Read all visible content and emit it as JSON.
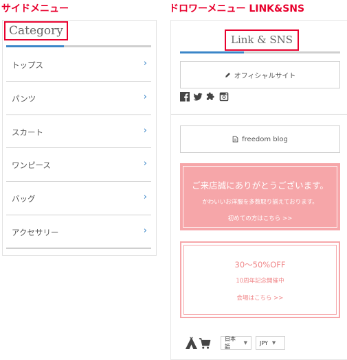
{
  "captions": {
    "side_menu": "サイドメニュー",
    "drawer_menu": "ドロワーメニュー LINK&SNS"
  },
  "side_menu": {
    "heading": "Category",
    "items": [
      {
        "label": "トップス",
        "icon": "chevron-right-icon"
      },
      {
        "label": "パンツ",
        "icon": "chevron-right-icon"
      },
      {
        "label": "スカート",
        "icon": "chevron-right-icon"
      },
      {
        "label": "ワンピース",
        "icon": "chevron-right-icon"
      },
      {
        "label": "バッグ",
        "icon": "chevron-right-icon"
      },
      {
        "label": "アクセサリー",
        "icon": "chevron-right-icon"
      }
    ],
    "chevron_glyph": "›"
  },
  "drawer": {
    "heading": "Link & SNS",
    "official_site": {
      "label": "オフィシャルサイト",
      "icon": "pencil-icon"
    },
    "sns_icons": [
      "facebook-icon",
      "twitter-icon",
      "puzzle-icon",
      "instagram-icon"
    ],
    "blog": {
      "label": "freedom blog",
      "icon": "document-icon"
    },
    "welcome_banner": {
      "title": "ご来店誠にありがとうございます。",
      "subtitle": "かわいいお洋服を多数取り揃えております。",
      "link": "初めての方はこちら >>"
    },
    "sale_banner": {
      "title": "30〜50%OFF",
      "subtitle": "10周年記念開催中",
      "link": "会場はこちら >>"
    },
    "footer": {
      "icons": [
        "tent-icon",
        "cart-icon"
      ],
      "language": {
        "selected": "日本語"
      },
      "currency": {
        "selected": "JPY"
      }
    }
  },
  "colors": {
    "caption_red": "#e8002d",
    "highlight_border": "#e8002d",
    "accent_blue": "#3b86c8",
    "banner_pink": "#f6a6a9",
    "sale_text": "#f08789",
    "divider_gray": "#cfcfcf"
  }
}
